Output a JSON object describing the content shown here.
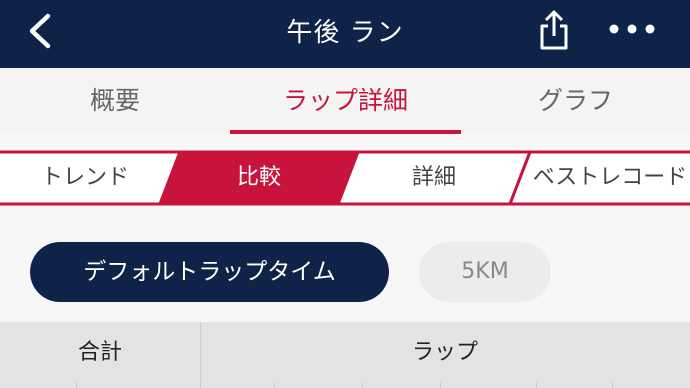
{
  "header": {
    "title": "午後 ラン",
    "back_icon": "chevron-left-icon",
    "share_icon": "share-icon",
    "more_icon": "more-horizontal-icon"
  },
  "tabs": [
    {
      "label": "概要",
      "active": false
    },
    {
      "label": "ラップ詳細",
      "active": true
    },
    {
      "label": "グラフ",
      "active": false
    }
  ],
  "segments": [
    {
      "label": "トレンド",
      "active": false
    },
    {
      "label": "比較",
      "active": true
    },
    {
      "label": "詳細",
      "active": false
    },
    {
      "label": "ベストレコード",
      "active": false
    }
  ],
  "filters": {
    "active": "デフォルトラップタイム",
    "other": "5KM"
  },
  "table": {
    "headers": [
      "合計",
      "ラップ"
    ]
  },
  "colors": {
    "header_bg": "#0f2348",
    "accent": "#c8143c",
    "pill_active_bg": "#0f2348"
  }
}
